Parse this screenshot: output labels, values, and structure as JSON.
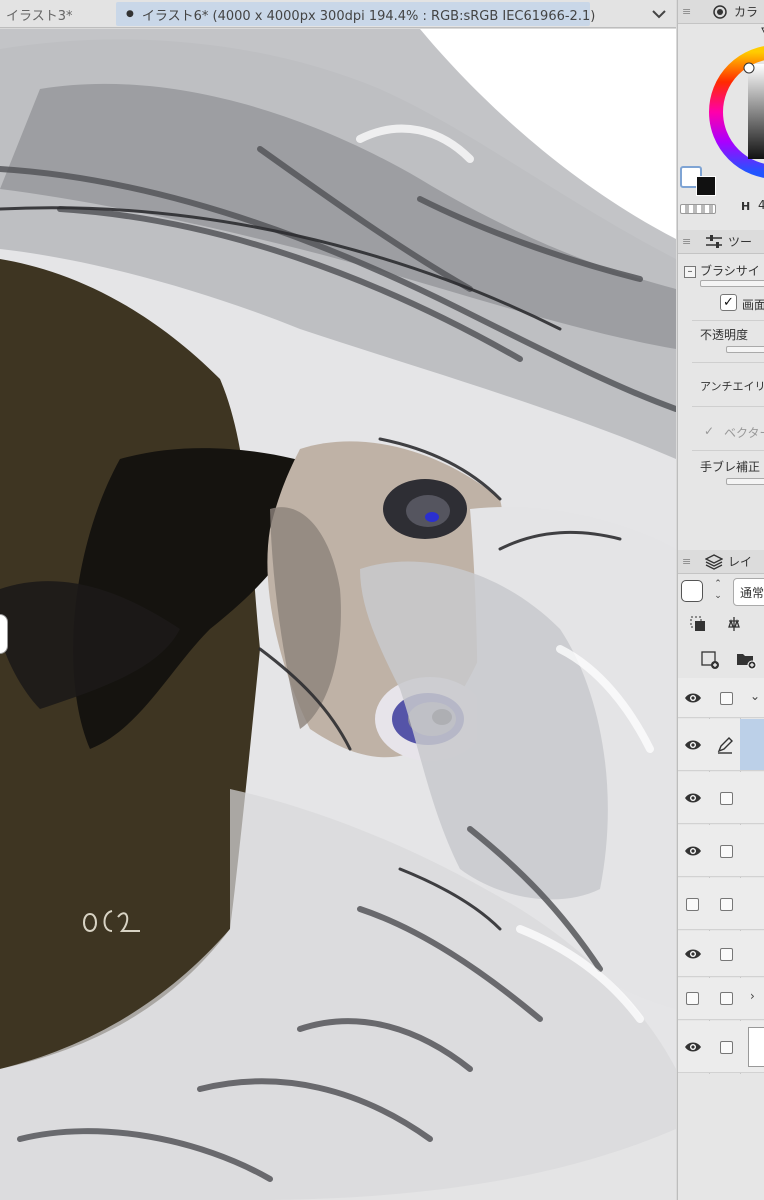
{
  "tabs": [
    {
      "label": "イラスト3*",
      "active": false
    },
    {
      "label": "イラスト6* (4000 x 4000px 300dpi 194.4% : RGB:sRGB IEC61966-2.1)",
      "active": true
    }
  ],
  "color_panel": {
    "title": "カラ",
    "hsv_label": "H",
    "hsv_value": "4"
  },
  "tool_panel": {
    "title": "ツー",
    "brush_size": "ブラシサイ",
    "screen_label": "画面",
    "opacity": "不透明度",
    "antialias": "アンチエイリア",
    "vector": "ベクター",
    "stabilization": "手ブレ補正"
  },
  "layer_panel": {
    "title": "レイ",
    "blend_mode": "通常"
  },
  "canvas": {
    "signature_text": "062"
  },
  "colors": {
    "tab_active": "#c9d7e8",
    "panel_bg": "#e6e6e6",
    "selected_layer": "#bcd0e8",
    "coat": "#3e3522",
    "hair": "#b9babe",
    "skin": "#bfb2a6",
    "iris": "#5554a8"
  }
}
